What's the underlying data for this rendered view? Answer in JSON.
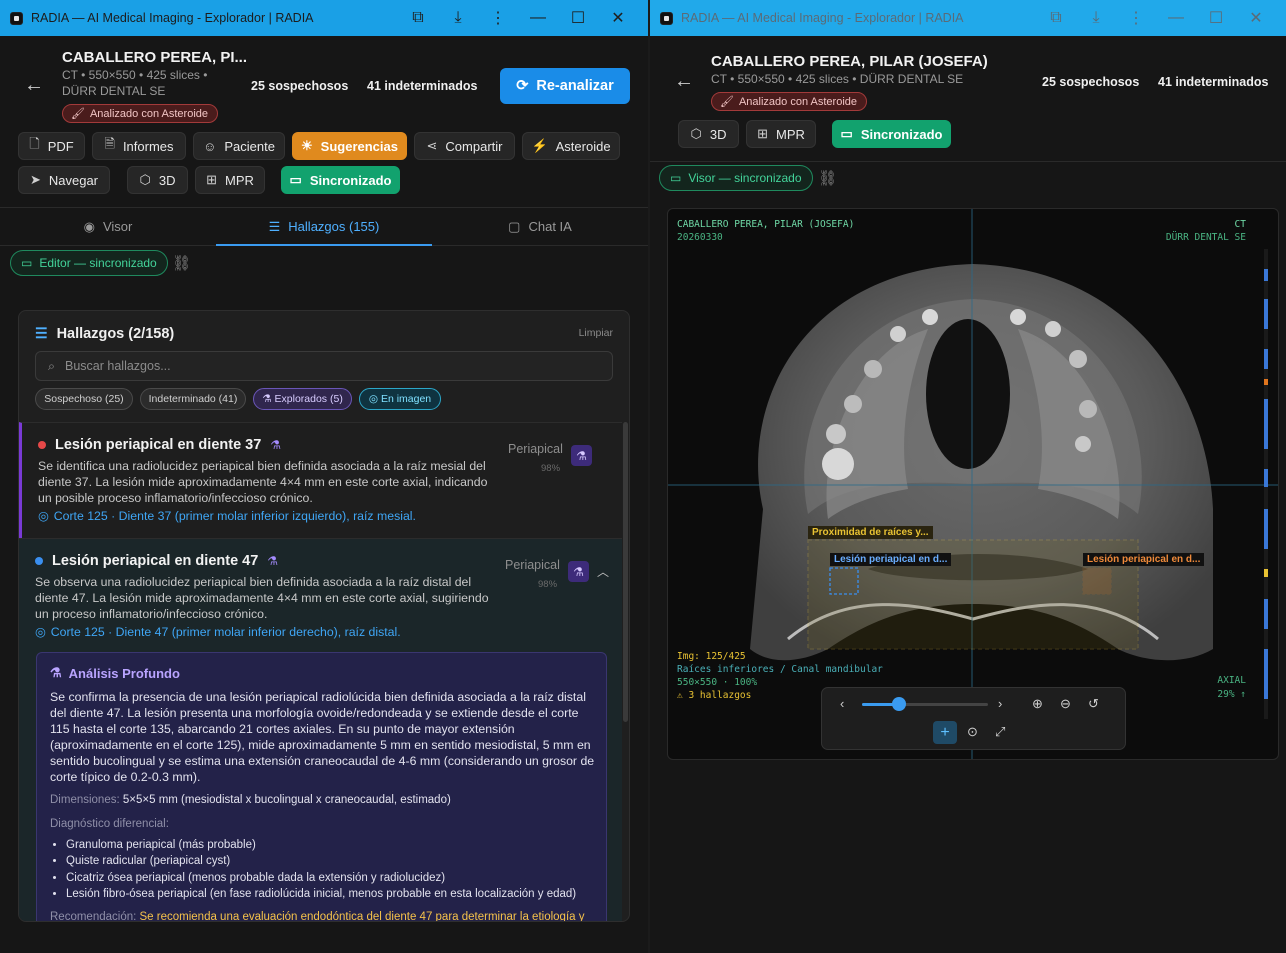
{
  "window": {
    "title": "RADIA — AI Medical Imaging - Explorador | RADIA"
  },
  "patient": {
    "name_short": "CABALLERO PEREA, PI...",
    "name_full": "CABALLERO PEREA, PILAR (JOSEFA)",
    "meta_line1": "CT • 550×550 • 425 slices •",
    "meta_line2": "DÜRR DENTAL SE",
    "meta_full": "CT • 550×550 • 425 slices • DÜRR DENTAL SE",
    "badge": "Analizado con Asteroide"
  },
  "counts": {
    "suspicious": "25 sospechosos",
    "indeterminate": "41 indeterminados"
  },
  "actions": {
    "reanalyze": "Re-analizar",
    "pdf": "PDF",
    "reports": "Informes",
    "patient": "Paciente",
    "suggestions": "Sugerencias",
    "share": "Compartir",
    "asteroid": "Asteroide",
    "navigate": "Navegar",
    "three_d": "3D",
    "mpr": "MPR",
    "synced": "Sincronizado"
  },
  "tabs": [
    {
      "label": "Visor"
    },
    {
      "label": "Hallazgos (155)"
    },
    {
      "label": "Chat IA"
    }
  ],
  "sync": {
    "editor": "Editor — sincronizado",
    "viewer": "Visor — sincronizado"
  },
  "findings_panel": {
    "title": "Hallazgos (2/158)",
    "clear": "Limpiar",
    "search_placeholder": "Buscar hallazgos...",
    "filters": [
      {
        "label": "Sospechoso (25)"
      },
      {
        "label": "Indeterminado (41)"
      },
      {
        "label": "Explorados (5)"
      },
      {
        "label": "En imagen"
      }
    ],
    "items": [
      {
        "title": "Lesión periapical en diente 37",
        "dot_color": "#e54848",
        "description": "Se identifica una radiolucidez periapical bien definida asociada a la raíz mesial del diente 37. La lesión mide aproximadamente 4×4 mm en este corte axial, indicando un posible proceso inflamatorio/infeccioso crónico.",
        "location": "Corte 125 · Diente 37 (primer molar inferior izquierdo), raíz mesial.",
        "category": "Periapical",
        "confidence": "98%"
      },
      {
        "title": "Lesión periapical en diente 47",
        "dot_color": "#3a8ff0",
        "description": "Se observa una radiolucidez periapical bien definida asociada a la raíz distal del diente 47. La lesión mide aproximadamente 4×4 mm en este corte axial, sugiriendo un proceso inflamatorio/infeccioso crónico.",
        "location": "Corte 125 · Diente 47 (primer molar inferior derecho), raíz distal.",
        "category": "Periapical",
        "confidence": "98%"
      }
    ],
    "analysis": {
      "title": "Análisis Profundo",
      "body": "Se confirma la presencia de una lesión periapical radiolúcida bien definida asociada a la raíz distal del diente 47. La lesión presenta una morfología ovoide/redondeada y se extiende desde el corte 115 hasta el corte 135, abarcando 21 cortes axiales. En su punto de mayor extensión (aproximadamente en el corte 125), mide aproximadamente 5 mm en sentido mesiodistal, 5 mm en sentido bucolingual y se estima una extensión craneocaudal de 4-6 mm (considerando un grosor de corte típico de 0.2-0.3 mm).",
      "dimensions_label": "Dimensiones:",
      "dimensions": "5×5×5 mm (mesiodistal x bucolingual x craneocaudal, estimado)",
      "differential_label": "Diagnóstico diferencial:",
      "differential": [
        "Granuloma periapical (más probable)",
        "Quiste radicular (periapical cyst)",
        "Cicatriz ósea periapical (menos probable dada la extensión y radiolucidez)",
        "Lesión fibro-ósea periapical (en fase radiolúcida inicial, menos probable en esta localización y edad)"
      ],
      "recommendation_label": "Recomendación:",
      "recommendation": "Se recomienda una evaluación endodóntica del diente 47 para determinar la etiología y"
    }
  },
  "viewer": {
    "patient": "CABALLERO PEREA, PILAR (JOSEFA)",
    "date": "20260330",
    "modality": "CT",
    "manufacturer": "DÜRR DENTAL SE",
    "image_index": "Img: 125/425",
    "region": "Raíces inferiores / Canal mandibular",
    "size_zoom": "550×550 · 100%",
    "findings_count": "⚠ 3 hallazgos",
    "plane": "AXIAL",
    "window_level": "29% ↑",
    "labels": {
      "proximity": "Proximidad de raíces y...",
      "lesion_left": "Lesión periapical en d...",
      "lesion_right": "Lesión periapical en d..."
    },
    "slice_fraction": 0.29
  },
  "colors": {
    "accent": "#1a8ce8",
    "green": "#12a26e",
    "orange": "#e08a1e",
    "purple": "#7a3ad6"
  }
}
